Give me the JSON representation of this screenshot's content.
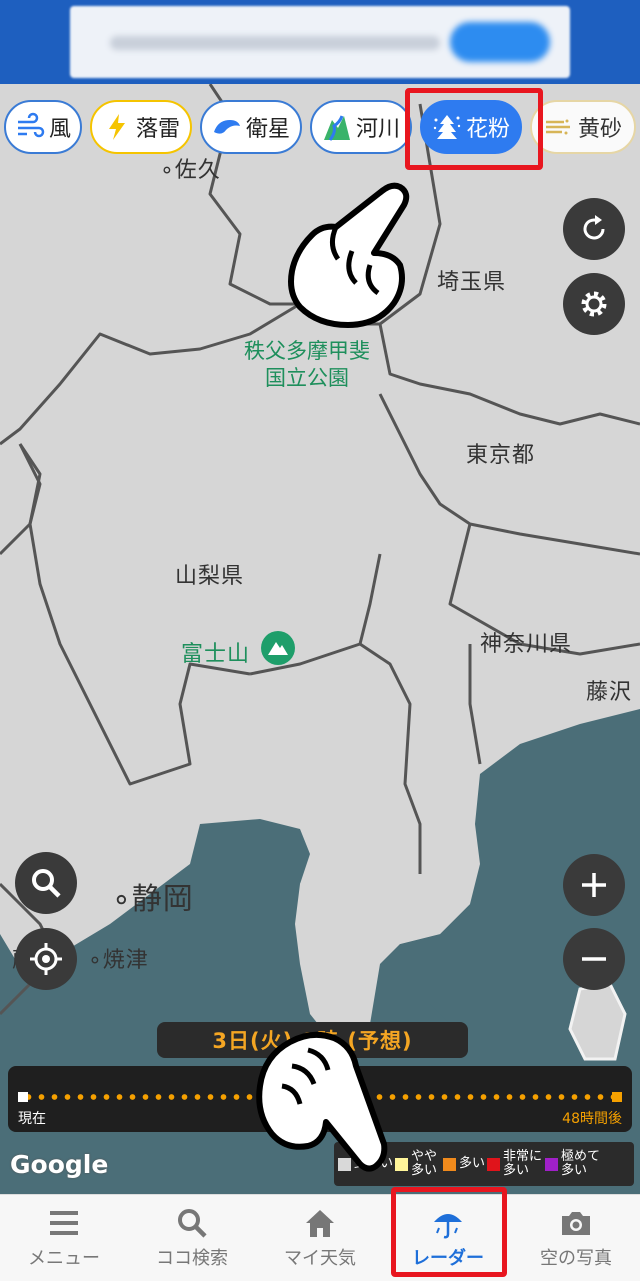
{
  "chips": [
    {
      "label": "風",
      "icon": "wind-icon"
    },
    {
      "label": "落雷",
      "icon": "lightning-icon"
    },
    {
      "label": "衛星",
      "icon": "satellite-icon"
    },
    {
      "label": "河川",
      "icon": "river-icon"
    },
    {
      "label": "花粉",
      "icon": "pollen-icon",
      "active": true
    },
    {
      "label": "黄砂",
      "icon": "yellow-sand-icon"
    }
  ],
  "map_labels": {
    "saku": "佐久",
    "saitama": "埼玉県",
    "park_line1": "秩父多摩甲斐",
    "park_line2": "国立公園",
    "tokyo": "東京都",
    "yamanashi": "山梨県",
    "fuji": "富士山",
    "kanagawa": "神奈川県",
    "fujisawa": "藤沢",
    "shizuoka": "静岡",
    "yaizu": "焼津",
    "fujieda": "藤枝"
  },
  "time": {
    "label": "3日(火) 9時 (予想)",
    "start_label": "現在",
    "end_label": "48時間後"
  },
  "legend": [
    {
      "label": "少ない",
      "color": "#d9d9d9"
    },
    {
      "label": "やや多い",
      "color": "#fff59a"
    },
    {
      "label": "多い",
      "color": "#f08a1c"
    },
    {
      "label": "非常に多い",
      "color": "#e0141b"
    },
    {
      "label": "極めて多い",
      "color": "#a020c8"
    }
  ],
  "attribution": "Google",
  "nav": [
    {
      "label": "メニュー",
      "icon": "menu-icon"
    },
    {
      "label": "ココ検索",
      "icon": "search-icon"
    },
    {
      "label": "マイ天気",
      "icon": "home-icon"
    },
    {
      "label": "レーダー",
      "icon": "radar-umbrella-icon",
      "active": true
    },
    {
      "label": "空の写真",
      "icon": "camera-icon"
    }
  ],
  "colors": {
    "accent_blue": "#2e7bf0",
    "highlight_red": "#e8161f",
    "timeline_orange": "#f5a000",
    "sea": "#4b6e78"
  }
}
